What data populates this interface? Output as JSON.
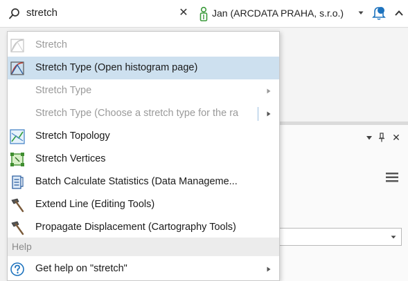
{
  "topbar": {
    "search_text": "stretch",
    "clear_label": "✕",
    "user_label": "Jan (ARCDATA PRAHA, s.r.o.)"
  },
  "pane": {
    "close_label": "✕"
  },
  "menu": {
    "items": [
      {
        "label": "Stretch",
        "icon": "stretch-tool-icon",
        "disabled": true
      },
      {
        "label": "Stretch Type (Open histogram page)",
        "icon": "stretch-tool-icon",
        "highlighted": true
      },
      {
        "label": "Stretch Type",
        "disabled": true,
        "submenu": true
      },
      {
        "label": "Stretch Type (Choose a stretch type for the ra",
        "disabled": true,
        "submenu": true
      },
      {
        "label": "Stretch Topology",
        "icon": "topology-icon"
      },
      {
        "label": "Stretch Vertices",
        "icon": "vertices-icon"
      },
      {
        "label": "Batch Calculate Statistics (Data Manageme...",
        "icon": "script-tool-icon"
      },
      {
        "label": "Extend Line (Editing Tools)",
        "icon": "hammer-icon"
      },
      {
        "label": "Propagate Displacement (Cartography Tools)",
        "icon": "hammer-icon"
      }
    ],
    "section_help": "Help",
    "help_item": {
      "label": "Get help on  \"stretch\"",
      "icon": "help-icon",
      "submenu": true
    }
  },
  "colors": {
    "highlight": "#cde0ef",
    "accent_blue": "#1e73be",
    "user_green": "#3a9a3a"
  }
}
